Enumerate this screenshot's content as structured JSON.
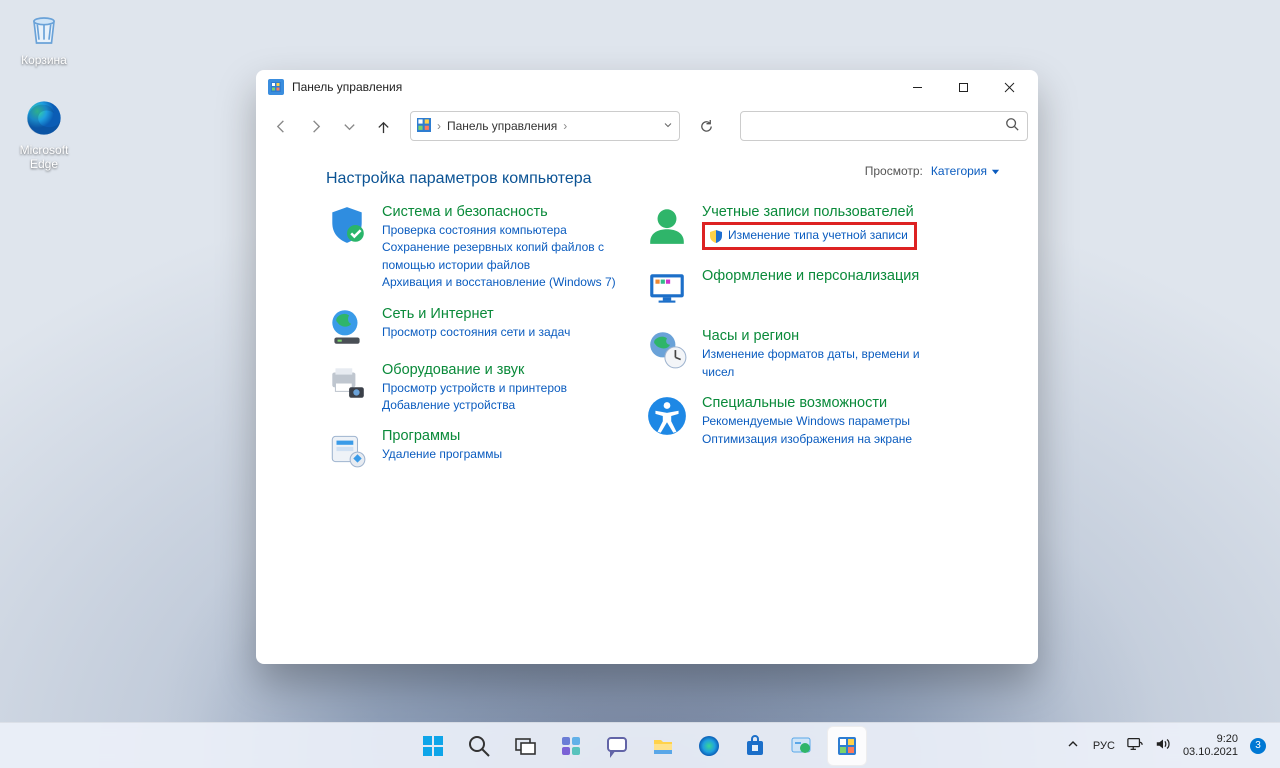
{
  "desktop": {
    "recycle_label": "Корзина",
    "edge_label": "Microsoft Edge"
  },
  "window": {
    "title": "Панель управления",
    "breadcrumb": "Панель управления",
    "heading": "Настройка параметров компьютера",
    "view_label": "Просмотр:",
    "view_value": "Категория"
  },
  "cats": {
    "system": {
      "title": "Система и безопасность",
      "l1": "Проверка состояния компьютера",
      "l2": "Сохранение резервных копий файлов с помощью истории файлов",
      "l3": "Архивация и восстановление (Windows 7)"
    },
    "network": {
      "title": "Сеть и Интернет",
      "l1": "Просмотр состояния сети и задач"
    },
    "hardware": {
      "title": "Оборудование и звук",
      "l1": "Просмотр устройств и принтеров",
      "l2": "Добавление устройства"
    },
    "programs": {
      "title": "Программы",
      "l1": "Удаление программы"
    },
    "accounts": {
      "title": "Учетные записи пользователей",
      "l1": "Изменение типа учетной записи"
    },
    "appearance": {
      "title": "Оформление и персонализация"
    },
    "clock": {
      "title": "Часы и регион",
      "l1": "Изменение форматов даты, времени и чисел"
    },
    "ease": {
      "title": "Специальные возможности",
      "l1": "Рекомендуемые Windows параметры",
      "l2": "Оптимизация изображения на экране"
    }
  },
  "tray": {
    "lang": "РУС",
    "time": "9:20",
    "date": "03.10.2021",
    "badge": "3"
  }
}
